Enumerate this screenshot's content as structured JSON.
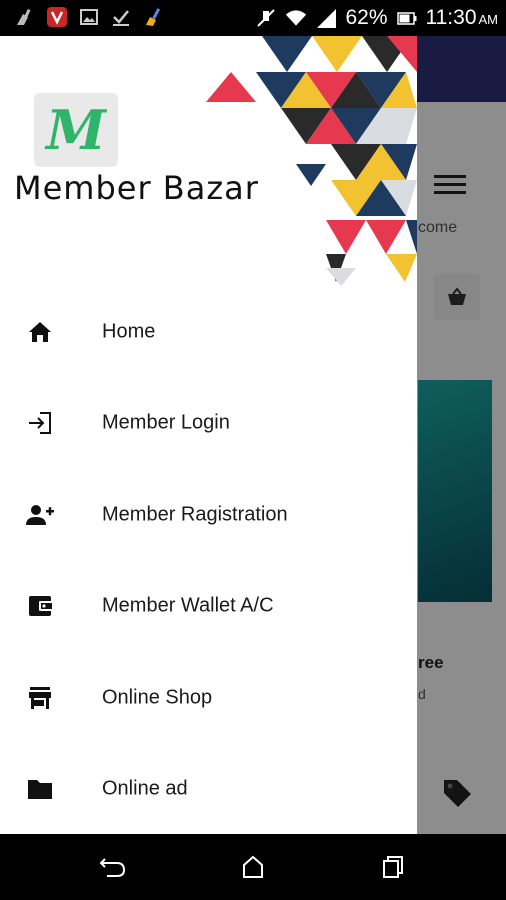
{
  "status_bar": {
    "battery": "62%",
    "time": "11:30",
    "ampm": "AM",
    "left_icons": [
      "clean-icon",
      "vivaldi-icon",
      "image-icon",
      "check-icon",
      "broom-icon"
    ],
    "right_icons": [
      "mute-icon",
      "wifi-icon",
      "signal-icon",
      "battery-icon"
    ]
  },
  "background_app": {
    "welcome_fragment": "come",
    "promo_title_fragment": "ree",
    "promo_sub_fragment": "d",
    "colors": {
      "topbar": "#2d2f72",
      "banner_start": "#1aa3a0",
      "banner_end": "#0a4f5c"
    }
  },
  "drawer": {
    "logo_letter": "M",
    "brand": "Member Bazar",
    "menu": [
      {
        "label": "Home",
        "icon": "home-icon"
      },
      {
        "label": "Member Login",
        "icon": "login-icon"
      },
      {
        "label": "Member Ragistration",
        "icon": "add-person-icon"
      },
      {
        "label": "Member Wallet A/C",
        "icon": "wallet-icon"
      },
      {
        "label": "Online Shop",
        "icon": "store-icon"
      },
      {
        "label": "Online ad",
        "icon": "folder-icon"
      }
    ],
    "colors": {
      "logo_green": "#2eb56a"
    }
  },
  "nav_bar": {
    "buttons": [
      "back-icon",
      "home-nav-icon",
      "recents-icon"
    ]
  }
}
